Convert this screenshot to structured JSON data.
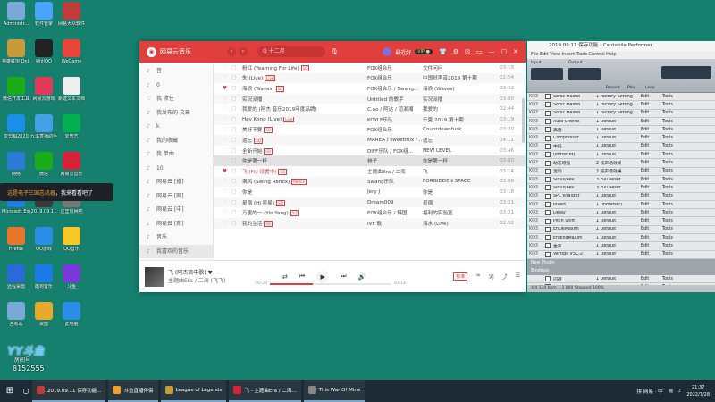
{
  "desktop": {
    "icons": [
      {
        "label": "Administr...",
        "color": "#7aa8d8"
      },
      {
        "label": "软件管家",
        "color": "#4aa3ff"
      },
      {
        "label": "网易大众软件",
        "color": "#c23b3b"
      },
      {
        "label": "英雄联盟 Online",
        "color": "#c99a3a"
      },
      {
        "label": "腾讯QQ",
        "color": "#222"
      },
      {
        "label": "WeGame",
        "color": "#e8443a"
      },
      {
        "label": "微信开发工具",
        "color": "#1aad19"
      },
      {
        "label": "网易云游戏",
        "color": "#e33a5a"
      },
      {
        "label": "新建文本文档",
        "color": "#eeeeee"
      },
      {
        "label": "爱剪辑2020",
        "color": "#1a8ee8"
      },
      {
        "label": "九溪直播助手",
        "color": "#46a0e8"
      },
      {
        "label": "爱奇艺",
        "color": "#00b050"
      },
      {
        "label": "网络",
        "color": "#2a7ad8"
      },
      {
        "label": "微信",
        "color": "#1aad19"
      },
      {
        "label": "网易云音乐",
        "color": "#d8223a"
      },
      {
        "label": "Microsoft Edge",
        "color": "#1a7ee0"
      },
      {
        "label": "2019.09.11",
        "color": "#3a3a3a"
      },
      {
        "label": "这里有网吧",
        "color": "#777777"
      },
      {
        "label": "Firefox",
        "color": "#e8752a"
      },
      {
        "label": "QQ游戏",
        "color": "#2a8ee8"
      },
      {
        "label": "QQ音乐",
        "color": "#f8c72a"
      },
      {
        "label": "远程桌面",
        "color": "#2a6ad8"
      },
      {
        "label": "酷狗音乐",
        "color": "#1a7ae8"
      },
      {
        "label": "斗鱼",
        "color": "#7a3ad8"
      },
      {
        "label": "回收站",
        "color": "#7aa8d8"
      },
      {
        "label": "桌面",
        "color": "#e8a82a"
      },
      {
        "label": "此电脑",
        "color": "#2a8ee8"
      }
    ],
    "tooltip": {
      "prefix": "",
      "orange": "这是电子三国志机器",
      "rest": "，我来看看吧了"
    },
    "live": {
      "brand": "YY斗鱼",
      "sub": "房间号",
      "id": "8152555"
    }
  },
  "music": {
    "title": "网易云音乐",
    "search_placeholder": "Q  十二月",
    "user": "最近好",
    "vip": "VIP ●",
    "sidebar": [
      {
        "icon": "♪",
        "label": "音"
      },
      {
        "icon": "♪",
        "label": "0"
      },
      {
        "icon": "♡",
        "label": "我 收任"
      },
      {
        "icon": "♪",
        "label": "我发布的 文章"
      },
      {
        "icon": "♪",
        "label": "k"
      },
      {
        "icon": "♪",
        "label": "我的收藏"
      },
      {
        "icon": "♪",
        "label": "我 单曲"
      },
      {
        "icon": "♪",
        "label": "10"
      },
      {
        "icon": "♪",
        "label": "网易云 [播]"
      },
      {
        "icon": "♪",
        "label": "网易云 [网]"
      },
      {
        "icon": "♪",
        "label": "网易云 [中]"
      },
      {
        "icon": "♪",
        "label": "网易云 [新]"
      },
      {
        "icon": "♪",
        "label": "音乐"
      },
      {
        "icon": "♪",
        "label": "我喜欢的音乐"
      }
    ],
    "songs": [
      {
        "title": "粉红 (Yearning For Life)",
        "tag": "SQ",
        "artist": "FOX组合乐",
        "album": "文件问问",
        "dur": "03:18",
        "liked": false
      },
      {
        "title": "失 (Live)",
        "tag": "Live",
        "artist": "FOX组合乐",
        "album": "中国好声音2019 第十期",
        "dur": "02:54",
        "liked": false
      },
      {
        "title": "海浪 (Waves)",
        "tag": "SQ",
        "artist": "FOX组合乐 / Swang...",
        "album": "海浪 (Waves)",
        "dur": "03:32",
        "liked": true
      },
      {
        "title": "实况派播",
        "tag": "",
        "artist": "Untitled 的歌手",
        "album": "实况派播",
        "dur": "03:00",
        "liked": false
      },
      {
        "title": "我爱的 (阿杰 音乐2019年度品牌)",
        "tag": "",
        "artist": "C.ao / 阿达 / 范湘湘",
        "album": "我爱的",
        "dur": "02:44",
        "liked": false
      },
      {
        "title": "Hey Kong (Live)",
        "tag": "Live",
        "artist": "KOYLE乐队",
        "album": "乐夏 2019 第十期",
        "dur": "03:19",
        "liked": false
      },
      {
        "title": "美好不要",
        "tag": "SQ",
        "artist": "FOX组合乐",
        "album": "Countdownfuck",
        "dur": "03:20",
        "liked": false
      },
      {
        "title": "遗忘",
        "tag": "SQ",
        "artist": "MAREA / sweetmix / ...",
        "album": "遗忘",
        "dur": "04:11",
        "liked": false
      },
      {
        "title": "全新开始",
        "tag": "SQ",
        "artist": "DIFF乐队 / FOX组...",
        "album": "NEW LEVEL",
        "dur": "03:46",
        "liked": false
      },
      {
        "title": "你是第一杯",
        "tag": "",
        "artist": "林子",
        "album": "你是第一杯",
        "dur": "03:00",
        "liked": false
      },
      {
        "title": "飞 (Fly 设置中)",
        "tag": "SQ",
        "artist": "主题曲Era / 二海",
        "album": "飞",
        "dur": "03:14",
        "liked": true
      },
      {
        "title": "满风 (Swing Remix)",
        "tag": "Remix",
        "artist": "Swang乐队",
        "album": "FORGIDDEN SPACC",
        "dur": "03:08",
        "liked": false
      },
      {
        "title": "你是",
        "tag": "",
        "artist": "Jery J",
        "album": "你是",
        "dur": "03:18",
        "liked": false
      },
      {
        "title": "星宿 (Hi 星星)",
        "tag": "SQ",
        "artist": "Dream009",
        "album": "星宿",
        "dur": "03:21",
        "liked": false
      },
      {
        "title": "万里的一 (Yin Yang)",
        "tag": "SQ",
        "artist": "FOX组合乐 / 韩国",
        "album": "福利的实验室",
        "dur": "03:21",
        "liked": false
      },
      {
        "title": "我的生活",
        "tag": "SQ",
        "artist": "IVF 歌",
        "album": "海水 (Live)",
        "dur": "02:52",
        "liked": false
      }
    ],
    "now_playing": {
      "title": "飞 (阿杰流中歌) ♥",
      "artist": "主题曲Era / 二海 (飞飞)"
    },
    "elapsed": "00:28",
    "total": "03:14",
    "progress": 0.35,
    "hq": "标准",
    "controls": {
      "prev": "⏮",
      "play": "▶",
      "next": "⏭",
      "mode": "⇄",
      "vol": "🔊"
    }
  },
  "cantabile": {
    "title": "2019.09.11 保存功能 - Cantabile Performer",
    "menu": "File  Edit  View  Insert  Tools  Control  Help",
    "tools": {
      "input": "Input",
      "output": "Output",
      "record": "Record",
      "play": "Play",
      "loop": "Loop",
      "tempo": "120 bpm",
      "bar": "1.1.000"
    },
    "section_routes": "Routes",
    "plugins": [
      {
        "num": "KQ3",
        "name": "Sonic Mastel",
        "preset": "1 Factory Setting",
        "edit": "Edit",
        "tools": "Tools"
      },
      {
        "num": "KQ3",
        "name": "Sonic Mastel",
        "preset": "1 Factory Setting",
        "edit": "Edit",
        "tools": "Tools"
      },
      {
        "num": "KQ3",
        "name": "Sonic Mastel",
        "preset": "1 Factory Setting",
        "edit": "Edit",
        "tools": "Tools"
      },
      {
        "num": "KQ3",
        "name": "Auto Chorus",
        "preset": "1 Default",
        "edit": "Edit",
        "tools": "Tools"
      },
      {
        "num": "KQ3",
        "name": "高音",
        "preset": "1 Default",
        "edit": "Edit",
        "tools": "Tools"
      },
      {
        "num": "KQ3",
        "name": "Compressor",
        "preset": "1 Default",
        "edit": "Edit",
        "tools": "Tools"
      },
      {
        "num": "KQ3",
        "name": "中低",
        "preset": "1 Default",
        "edit": "Edit",
        "tools": "Tools"
      },
      {
        "num": "KQ3",
        "name": "(Inmatter)",
        "preset": "1 Default",
        "edit": "Edit",
        "tools": "Tools"
      },
      {
        "num": "KQ3",
        "name": "动态增强",
        "preset": "2 按声场效果",
        "edit": "Edit",
        "tools": "Tools"
      },
      {
        "num": "KQ3",
        "name": "混响",
        "preset": "2 按声场效果",
        "edit": "Edit",
        "tools": "Tools"
      },
      {
        "num": "KQ3",
        "name": "Sinus/Rev",
        "preset": "3 Full Reset",
        "edit": "Edit",
        "tools": "Tools"
      },
      {
        "num": "KQ3",
        "name": "Sinus/Rev",
        "preset": "3 Full Reset",
        "edit": "Edit",
        "tools": "Tools"
      },
      {
        "num": "KQ3",
        "name": "SPL Vitalizer",
        "preset": "1 Default",
        "edit": "Edit",
        "tools": "Tools"
      },
      {
        "num": "KQ3",
        "name": "Invert",
        "preset": "1 (Inmatter)",
        "edit": "Edit",
        "tools": "Tools"
      },
      {
        "num": "KQ3",
        "name": "Delay",
        "preset": "1 Default",
        "edit": "Edit",
        "tools": "Tools"
      },
      {
        "num": "KQ3",
        "name": "Pitch Shift",
        "preset": "1 Default",
        "edit": "Edit",
        "tools": "Tools"
      },
      {
        "num": "KQ3",
        "name": "EnDeMaxim",
        "preset": "1 Default",
        "edit": "Edit",
        "tools": "Tools"
      },
      {
        "num": "KQ3",
        "name": "EndingMaxim",
        "preset": "1 Default",
        "edit": "Edit",
        "tools": "Tools"
      },
      {
        "num": "KQ3",
        "name": "金声",
        "preset": "1 Default",
        "edit": "Edit",
        "tools": "Tools"
      },
      {
        "num": "KQ3",
        "name": "Vertigo VSC-2",
        "preset": "1 Default",
        "edit": "Edit",
        "tools": "Tools"
      }
    ],
    "new_plugin": "New Plugin",
    "section_bindings": "Bindings",
    "lower": [
      {
        "num": "",
        "name": "闪避",
        "preset": "1 Default",
        "edit": "Edit",
        "tools": "Tools"
      },
      {
        "num": "",
        "name": "闪避",
        "preset": "1 Default",
        "edit": "Edit",
        "tools": "Tools"
      },
      {
        "num": "",
        "name": "伴奏",
        "preset": "1 Default",
        "edit": "Edit",
        "tools": "Tools"
      }
    ],
    "status": "4/4    120 bpm    1.1.000    Stopped    100%"
  },
  "taskbar": {
    "tasks": [
      {
        "label": "2019.09.11 保存功能...",
        "color": "#c23b3b"
      },
      {
        "label": "斗鱼直播伴侣",
        "color": "#f0a02a"
      },
      {
        "label": "League of Legends",
        "color": "#c99a3a"
      },
      {
        "label": "飞 - 主题曲Era / 二海...",
        "color": "#d8223a"
      },
      {
        "label": "This War Of Mine",
        "color": "#888888"
      }
    ],
    "tray_text": "拼 网易 · 中",
    "time": "21:37",
    "date": "2022/7/28"
  }
}
